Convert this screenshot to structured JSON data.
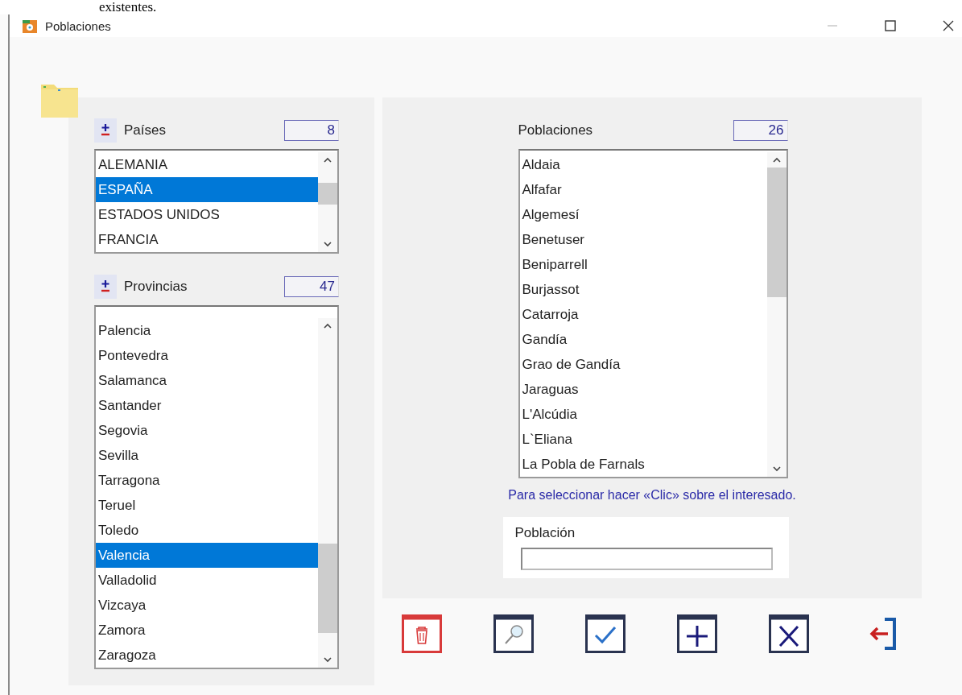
{
  "page_text": "existentes.",
  "window": {
    "title": "Poblaciones"
  },
  "paises": {
    "title": "Países",
    "count": "8",
    "items": [
      {
        "label": "ALEMANIA",
        "selected": false
      },
      {
        "label": "ESPAÑA",
        "selected": true
      },
      {
        "label": "ESTADOS UNIDOS",
        "selected": false
      },
      {
        "label": "FRANCIA",
        "selected": false
      }
    ]
  },
  "provincias": {
    "title": "Provincias",
    "count": "47",
    "items": [
      {
        "label": "Palencia",
        "selected": false
      },
      {
        "label": "Pontevedra",
        "selected": false
      },
      {
        "label": "Salamanca",
        "selected": false
      },
      {
        "label": "Santander",
        "selected": false
      },
      {
        "label": "Segovia",
        "selected": false
      },
      {
        "label": "Sevilla",
        "selected": false
      },
      {
        "label": "Tarragona",
        "selected": false
      },
      {
        "label": "Teruel",
        "selected": false
      },
      {
        "label": "Toledo",
        "selected": false
      },
      {
        "label": "Valencia",
        "selected": true
      },
      {
        "label": "Valladolid",
        "selected": false
      },
      {
        "label": "Vizcaya",
        "selected": false
      },
      {
        "label": "Zamora",
        "selected": false
      },
      {
        "label": "Zaragoza",
        "selected": false
      }
    ]
  },
  "poblaciones": {
    "title": "Poblaciones",
    "count": "26",
    "items": [
      {
        "label": "Aldaia",
        "selected": false
      },
      {
        "label": "Alfafar",
        "selected": false
      },
      {
        "label": "Algemesí",
        "selected": false
      },
      {
        "label": "Benetuser",
        "selected": false
      },
      {
        "label": "Beniparrell",
        "selected": false
      },
      {
        "label": "Burjassot",
        "selected": false
      },
      {
        "label": "Catarroja",
        "selected": false
      },
      {
        "label": "Gandía",
        "selected": false
      },
      {
        "label": "Grao de Gandía",
        "selected": false
      },
      {
        "label": "Jaraguas",
        "selected": false
      },
      {
        "label": "L'Alcúdia",
        "selected": false
      },
      {
        "label": "L`Eliana",
        "selected": false
      },
      {
        "label": "La Pobla de Farnals",
        "selected": false
      }
    ]
  },
  "hint": "Para seleccionar hacer «Clic» sobre el interesado.",
  "poblacion_field": {
    "label": "Población"
  },
  "toolbar": [
    {
      "kind": "delete"
    },
    {
      "kind": "search"
    },
    {
      "kind": "accept"
    },
    {
      "kind": "add"
    },
    {
      "kind": "cancel"
    },
    {
      "kind": "exit"
    }
  ]
}
